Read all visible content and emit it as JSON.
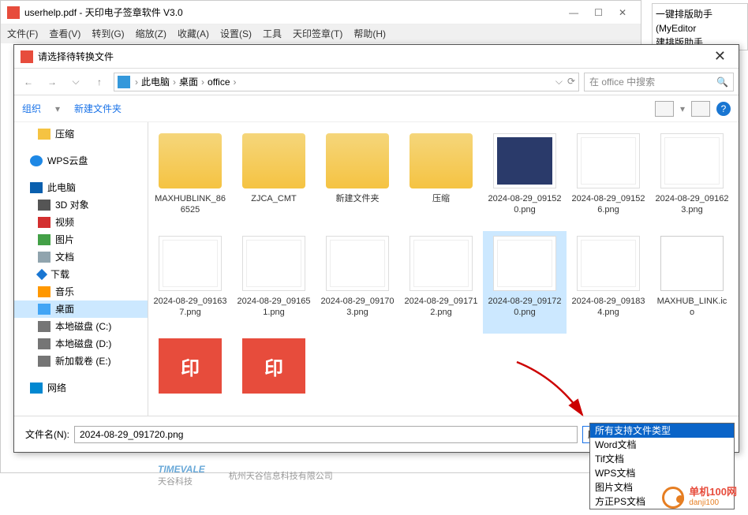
{
  "bgWindow": {
    "title": "userhelp.pdf - 天印电子签章软件 V3.0",
    "menu": [
      "文件(F)",
      "查看(V)",
      "转到(G)",
      "缩放(Z)",
      "收藏(A)",
      "设置(S)",
      "工具",
      "天印签章(T)",
      "帮助(H)"
    ]
  },
  "sideWindow": {
    "line1": "一键排版助手(MyEditor",
    "line2": "建排版助手"
  },
  "dialog": {
    "title": "请选择待转换文件",
    "breadcrumbs": [
      "此电脑",
      "桌面",
      "office"
    ],
    "searchPlaceholder": "在 office 中搜索",
    "toolbar": {
      "organize": "组织",
      "newFolder": "新建文件夹"
    },
    "filenameLabel": "文件名(N):",
    "filenameValue": "2024-08-29_091720.png",
    "typeLabel": "所有支持文件类型"
  },
  "tree": [
    {
      "id": "compress",
      "label": "压缩",
      "icon": "ic-folder",
      "level": 1
    },
    {
      "id": "wps",
      "label": "WPS云盘",
      "icon": "ic-wps",
      "level": 0
    },
    {
      "id": "pc",
      "label": "此电脑",
      "icon": "ic-pc",
      "level": 0
    },
    {
      "id": "3d",
      "label": "3D 对象",
      "icon": "ic-3d",
      "level": 1
    },
    {
      "id": "video",
      "label": "视频",
      "icon": "ic-video",
      "level": 1
    },
    {
      "id": "pics",
      "label": "图片",
      "icon": "ic-pic",
      "level": 1
    },
    {
      "id": "docs",
      "label": "文档",
      "icon": "ic-doc",
      "level": 1
    },
    {
      "id": "down",
      "label": "下载",
      "icon": "ic-down",
      "level": 1
    },
    {
      "id": "music",
      "label": "音乐",
      "icon": "ic-music",
      "level": 1
    },
    {
      "id": "desktop",
      "label": "桌面",
      "icon": "ic-desk",
      "level": 1,
      "sel": true
    },
    {
      "id": "diskc",
      "label": "本地磁盘 (C:)",
      "icon": "ic-disk",
      "level": 1
    },
    {
      "id": "diskd",
      "label": "本地磁盘 (D:)",
      "icon": "ic-disk",
      "level": 1
    },
    {
      "id": "diske",
      "label": "新加载卷 (E:)",
      "icon": "ic-disk",
      "level": 1
    },
    {
      "id": "network",
      "label": "网络",
      "icon": "ic-net",
      "level": 0
    }
  ],
  "files": [
    {
      "id": "maxhub",
      "label": "MAXHUBLINK_866525",
      "type": "folder"
    },
    {
      "id": "zjca",
      "label": "ZJCA_CMT",
      "type": "folder"
    },
    {
      "id": "newfolder",
      "label": "新建文件夹",
      "type": "folder"
    },
    {
      "id": "compressf",
      "label": "压缩",
      "type": "folder"
    },
    {
      "id": "p1520",
      "label": "2024-08-29_091520.png",
      "type": "png-dark"
    },
    {
      "id": "p1526",
      "label": "2024-08-29_091526.png",
      "type": "png-white"
    },
    {
      "id": "p1623",
      "label": "2024-08-29_091623.png",
      "type": "png-white"
    },
    {
      "id": "p1637",
      "label": "2024-08-29_091637.png",
      "type": "png-white"
    },
    {
      "id": "p1651",
      "label": "2024-08-29_091651.png",
      "type": "png-white"
    },
    {
      "id": "p1703",
      "label": "2024-08-29_091703.png",
      "type": "png-white"
    },
    {
      "id": "p1712",
      "label": "2024-08-29_091712.png",
      "type": "png-white"
    },
    {
      "id": "p1720",
      "label": "2024-08-29_091720.png",
      "type": "png-white",
      "sel": true
    },
    {
      "id": "p1834",
      "label": "2024-08-29_091834.png",
      "type": "png-white"
    },
    {
      "id": "ico",
      "label": "MAXHUB_LINK.ico",
      "type": "ico"
    },
    {
      "id": "logo1",
      "label": "",
      "type": "orange"
    },
    {
      "id": "logo2",
      "label": "",
      "type": "orange"
    }
  ],
  "dropdown": [
    {
      "label": "所有支持文件类型",
      "sel": true
    },
    {
      "label": "Word文档"
    },
    {
      "label": "Tif文档"
    },
    {
      "label": "WPS文档"
    },
    {
      "label": "图片文档"
    },
    {
      "label": "方正PS文档"
    }
  ],
  "footer": {
    "logo": "TIMEVALE",
    "sub": "天谷科技",
    "addr": "杭州天谷信息科技有限公司"
  },
  "watermark": {
    "name": "单机100网",
    "sub": "danji100"
  }
}
